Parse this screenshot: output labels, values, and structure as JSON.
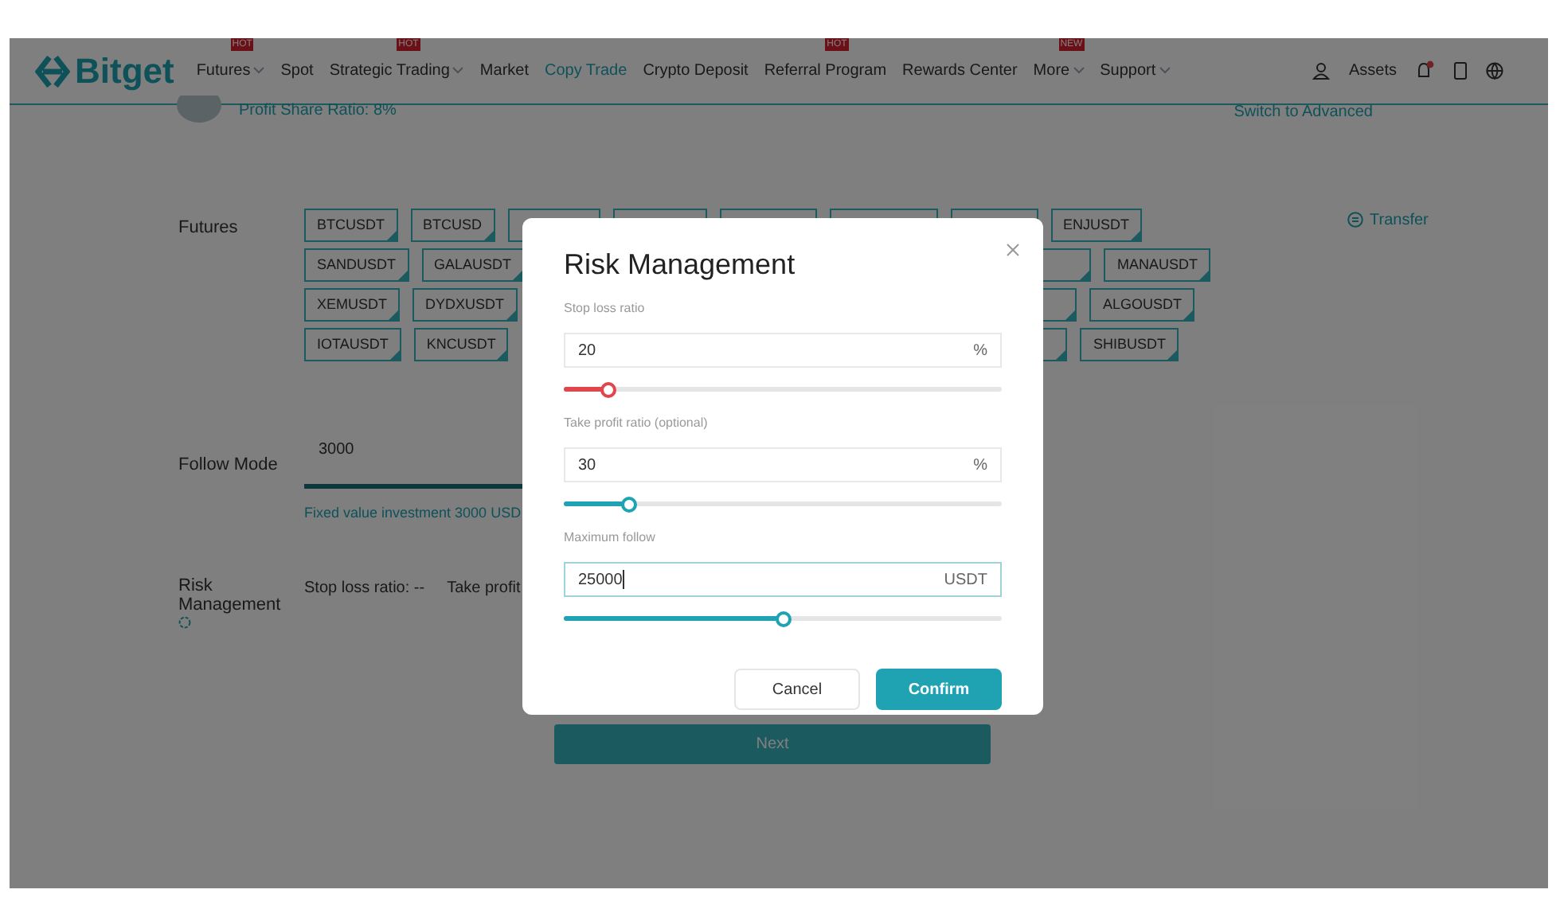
{
  "header": {
    "logo": "Bitget",
    "nav": [
      {
        "label": "Futures",
        "badge": "HOT",
        "dropdown": true,
        "selected": false
      },
      {
        "label": "Spot",
        "dropdown": false,
        "selected": false
      },
      {
        "label": "Strategic Trading",
        "badge": "HOT",
        "dropdown": true,
        "selected": false
      },
      {
        "label": "Market",
        "dropdown": false,
        "selected": false
      },
      {
        "label": "Copy Trade",
        "dropdown": false,
        "selected": true
      },
      {
        "label": "Crypto Deposit",
        "dropdown": false,
        "selected": false
      },
      {
        "label": "Referral Program",
        "badge": "HOT",
        "dropdown": false,
        "selected": false
      },
      {
        "label": "Rewards Center",
        "dropdown": false,
        "selected": false
      },
      {
        "label": "More",
        "badge": "NEW",
        "dropdown": true,
        "selected": false
      },
      {
        "label": "Support",
        "dropdown": true,
        "selected": false
      }
    ],
    "assets": "Assets",
    "notification": true
  },
  "trader": {
    "profit_share": "Profit Share Ratio: 8%",
    "switch_link": "Switch to Advanced"
  },
  "futures": {
    "label": "Futures",
    "transfer": "Transfer",
    "rows": [
      {
        "left": [
          "BTCUSDT",
          "BTCUSD"
        ],
        "right": "ENJUSDT"
      },
      {
        "left": [
          "SANDUSDT",
          "GALAUSDT"
        ],
        "right": "MANAUSDT"
      },
      {
        "left": [
          "XEMUSDT",
          "DYDXUSDT"
        ],
        "right": "ALGOUSDT"
      },
      {
        "left": [
          "IOTAUSDT",
          "KNCUSDT"
        ],
        "right": "SHIBUSDT"
      }
    ]
  },
  "follow_mode": {
    "label": "Follow Mode",
    "value": "3000",
    "note": "Fixed value investment 3000 USD"
  },
  "risk": {
    "label": "Risk Management",
    "stop_loss": "Stop loss ratio: --",
    "take_profit": "Take profit"
  },
  "next_button": "Next",
  "modal": {
    "title": "Risk Management",
    "fields": [
      {
        "label": "Stop loss ratio",
        "value": "20",
        "unit": "%",
        "level": 0.1,
        "color": "#e0474c",
        "focused": false
      },
      {
        "label": "Take profit ratio (optional)",
        "value": "30",
        "unit": "%",
        "level": 0.15,
        "color": "#1fa3b3",
        "focused": false
      },
      {
        "label": "Maximum follow",
        "value": "25000",
        "unit": "USDT",
        "level": 0.5,
        "color": "#1fa3b3",
        "focused": true
      }
    ],
    "buttons": [
      {
        "label": "Cancel",
        "kind": "secondary"
      },
      {
        "label": "Confirm",
        "kind": "primary"
      }
    ]
  }
}
